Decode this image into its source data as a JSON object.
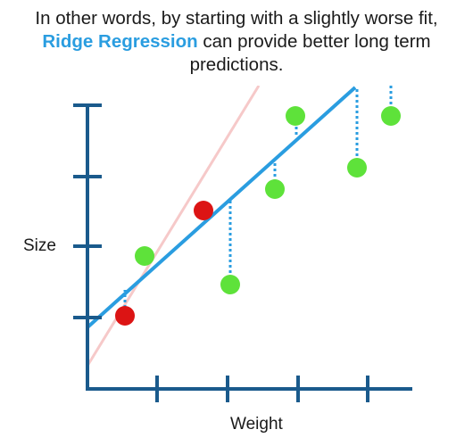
{
  "caption": {
    "line1": "In other words, by starting with a slightly worse fit,",
    "highlight": "Ridge Regression",
    "line2_rest": " can provide better long term",
    "line3": "predictions."
  },
  "axes": {
    "x_label": "Weight",
    "y_label": "Size"
  },
  "colors": {
    "axis": "#1a5a8c",
    "ridge_line": "#2a9de0",
    "ols_line": "#f6c9c9",
    "residual": "#2a9de0",
    "test_point": "#5ee23a",
    "train_point": "#dc1414",
    "highlight_text": "#2a9de0"
  },
  "legend_free_marks": {
    "lines": [
      "ridge-regression-line",
      "least-squares-line"
    ],
    "point_types": [
      "training-point",
      "testing-point"
    ]
  }
}
